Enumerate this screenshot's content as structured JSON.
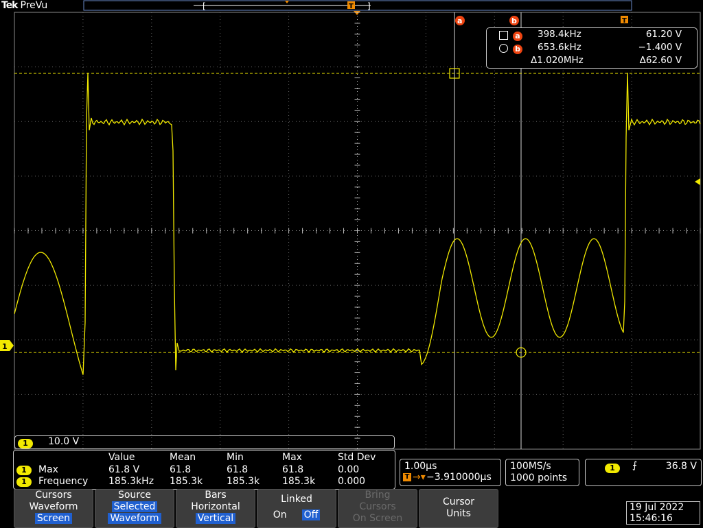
{
  "header": {
    "brand": "Tek",
    "mode": "PreVu"
  },
  "trigger_marker": "T",
  "ground_marker": "1",
  "cursor_labels": {
    "a": "a",
    "b": "b"
  },
  "cursor_readout": {
    "a": {
      "label": "a",
      "freq": "398.4kHz",
      "volt": "61.20 V"
    },
    "b": {
      "label": "b",
      "freq": "653.6kHz",
      "volt": "−1.400 V"
    },
    "delta": {
      "freq": "Δ1.020MHz",
      "volt": "Δ62.60 V"
    }
  },
  "channel_scale": {
    "channel": "1",
    "value": "10.0 V"
  },
  "measurements": {
    "headers": [
      "Value",
      "Mean",
      "Min",
      "Max",
      "Std Dev"
    ],
    "rows": [
      {
        "channel": "1",
        "name": "Max",
        "values": [
          "61.8 V",
          "61.8",
          "61.8",
          "61.8",
          "0.00"
        ]
      },
      {
        "channel": "1",
        "name": "Frequency",
        "values": [
          "185.3kHz",
          "185.3k",
          "185.3k",
          "185.3k",
          "0.000"
        ]
      }
    ]
  },
  "timebase": {
    "scale": "1.00µs",
    "position": "−3.910000µs",
    "trigger_icon": "T"
  },
  "acquisition": {
    "rate": "100MS/s",
    "points": "1000 points"
  },
  "trigger": {
    "channel": "1",
    "slope_icon": "rising-edge-icon",
    "slope_glyph": "⨍",
    "level": "36.8 V"
  },
  "softkeys": [
    {
      "line1": "Cursors",
      "line2": "Waveform",
      "line3": "Screen",
      "highlight": 3
    },
    {
      "line1": "Source",
      "line2": "Selected",
      "line3": "Waveform",
      "highlight": 2
    },
    {
      "line1": "Bars",
      "line2": "Horizontal",
      "line3": "Vertical",
      "highlight": 3
    },
    {
      "line1": "Linked",
      "line2": "On",
      "line3": "Off",
      "highlight": 3
    },
    {
      "line1": "Bring",
      "line2": "Cursors",
      "line3": "On Screen",
      "disabled": true
    },
    {
      "line1": "Cursor",
      "line2": "Units",
      "line3": ""
    }
  ],
  "datetime": {
    "date": "19 Jul  2022",
    "time": "15:46:16"
  },
  "colors": {
    "trace": "#f2ea00",
    "cursor_marker": "#ee4411",
    "softkey_bg": "#3c3c3c",
    "highlight": "#2060d0"
  }
}
